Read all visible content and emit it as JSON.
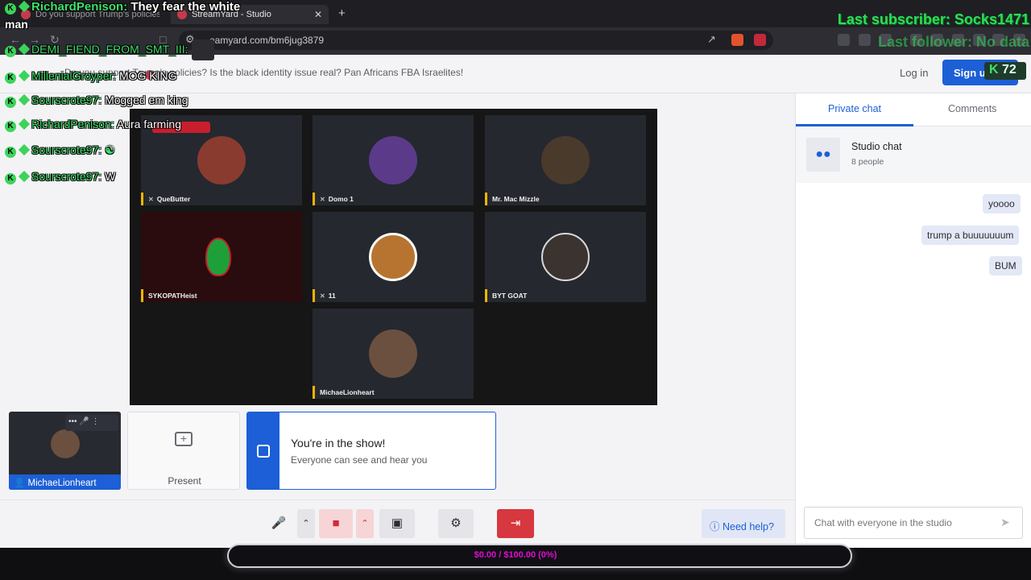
{
  "browser": {
    "tabs": [
      {
        "label": "Do you support Trump's policies? B"
      },
      {
        "label": "StreamYard - Studio",
        "close": "✕"
      }
    ],
    "new_tab": "+",
    "url": "eamyard.com/bm6jug3879"
  },
  "header": {
    "title": "Do you support Trump's policies? Is the black identity issue real? Pan Africans FBA Israelites!",
    "login": "Log in",
    "signup": "Sign up free"
  },
  "stage": {
    "tiles": [
      {
        "name": "QueButter",
        "muted": true,
        "color": "#8a3b30"
      },
      {
        "name": "Domo 1",
        "muted": true,
        "color": "#5b3a8a"
      },
      {
        "name": "Mr. Mac Mizzle",
        "muted": false,
        "color": "#4a3a2c"
      },
      {
        "name": "SYKOPATHeist",
        "muted": false,
        "color": "#1f9f3a"
      },
      {
        "name": "11",
        "muted": true,
        "color": "#b77430"
      },
      {
        "name": "BYT GOAT",
        "muted": false,
        "color": "#3a3330"
      },
      {
        "name": "MichaeLionheart",
        "muted": false,
        "color": "#6b5040"
      }
    ]
  },
  "camera": {
    "name": "MichaeLionheart"
  },
  "present": {
    "label": "Present"
  },
  "inshow": {
    "title": "You're in the show!",
    "subtitle": "Everyone can see and hear you"
  },
  "toolbar": {
    "help": "Need help?"
  },
  "panel": {
    "tabs": [
      "Private chat",
      "Comments"
    ],
    "studio_chat": {
      "title": "Studio chat",
      "people": "8 people"
    },
    "messages": [
      "yoooo",
      "trump a buuuuuuum",
      "BUM"
    ],
    "input_placeholder": "Chat with everyone in the studio"
  },
  "donation": {
    "text": "$0.00 / $100.00 (0%)"
  },
  "overlay": {
    "chat": [
      {
        "user": "RichardPenison:",
        "text": "They fear the white"
      },
      {
        "user": "DEMI_FIEND_FROM_SMT_III:",
        "text": ""
      },
      {
        "user": "MillenialGroyper:",
        "text": "MOG KING"
      },
      {
        "user": "Sourscrote97:",
        "text": "Mogged em king"
      },
      {
        "user": "RichardPenison:",
        "text": "Aura farming"
      },
      {
        "user": "Sourscrote97:",
        "text": ""
      },
      {
        "user": "Sourscrote97:",
        "text": "W"
      }
    ],
    "continuation": "man",
    "last_subscriber": "Last subscriber: Socks1471",
    "last_follower": "Last follower: No data",
    "count": "72"
  },
  "colors": {
    "accent": "#1c5fd6",
    "end_button": "#d7373e",
    "overlay_green": "#3fe06a",
    "donation_text": "#e10bd4"
  }
}
